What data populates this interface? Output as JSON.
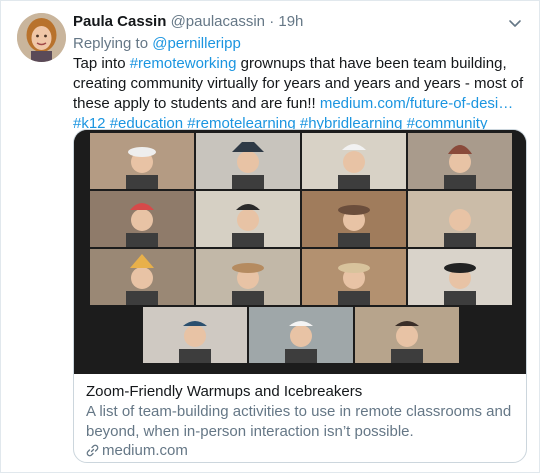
{
  "author": {
    "name": "Paula Cassin",
    "handle": "@paulacassin",
    "separator": "·",
    "time": "19h"
  },
  "reply": {
    "prefix": "Replying to",
    "handle": "@pernilleripp"
  },
  "body": {
    "text_1": "Tap into ",
    "hashtag_1": "#remoteworking",
    "text_2": " grownups that have been team building, creating community virtually for years and years and years - most of these apply to students and are fun!! ",
    "url": "medium.com/future-of-desi…",
    "hashtag_2": "#k12",
    "hashtag_3": "#education",
    "hashtag_4": "#remotelearning",
    "hashtag_5": "#hybridlearning",
    "hashtag_6": "#community"
  },
  "card": {
    "title": "Zoom-Friendly Warmups and Icebreakers",
    "description": "A list of team-building activities to use in remote classrooms and beyond, when in-person interaction isn’t possible.",
    "domain": "medium.com"
  },
  "icons": {
    "menu": "chevron-down-icon",
    "link": "link-icon"
  },
  "colors": {
    "link": "#1b95e0",
    "secondary_text": "#657786",
    "card_border": "#ccd6dd"
  }
}
